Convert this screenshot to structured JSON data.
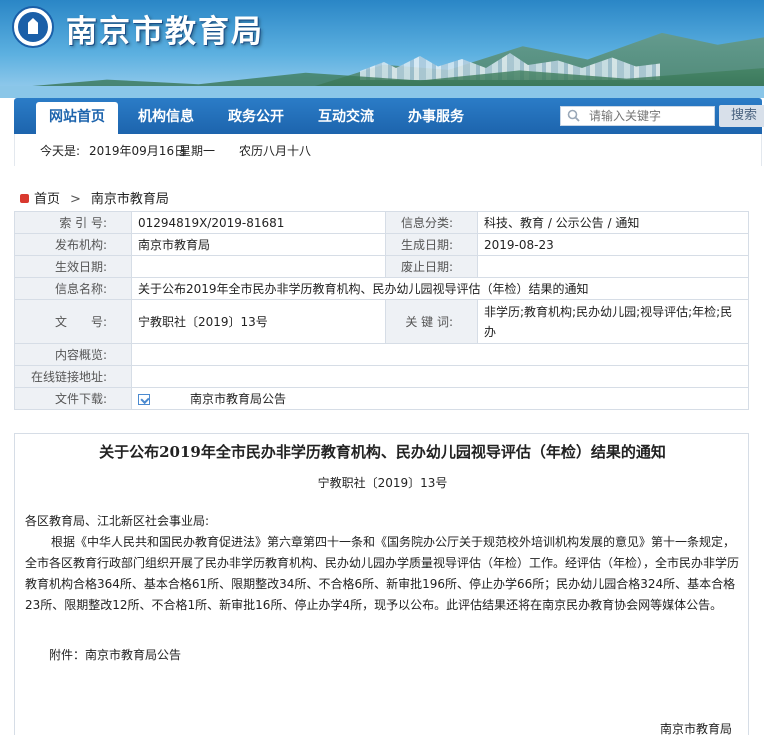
{
  "header": {
    "site_title": "南京市教育局"
  },
  "nav": {
    "items": [
      "网站首页",
      "机构信息",
      "政务公开",
      "互动交流",
      "办事服务"
    ],
    "search_placeholder": "请输入关键字",
    "search_button": "搜索"
  },
  "datebar": {
    "today_label": "今天是:",
    "date": "2019年09月16日",
    "weekday": "星期一",
    "lunar": "农历八月十八"
  },
  "breadcrumb": {
    "home": "首页",
    "current": "南京市教育局"
  },
  "meta": {
    "index_label": "索 引 号:",
    "index_value": "01294819X/2019-81681",
    "category_label": "信息分类:",
    "category_value": "科技、教育 / 公示公告 / 通知",
    "publisher_label": "发布机构:",
    "publisher_value": "南京市教育局",
    "created_label": "生成日期:",
    "created_value": "2019-08-23",
    "effective_label": "生效日期:",
    "effective_value": "",
    "repeal_label": "废止日期:",
    "repeal_value": "",
    "name_label": "信息名称:",
    "name_value": "关于公布2019年全市民办非学历教育机构、民办幼儿园视导评估（年检）结果的通知",
    "docno_label": "文　　号:",
    "docno_value": "宁教职社〔2019〕13号",
    "keywords_label": "关 键 词:",
    "keywords_value": "非学历;教育机构;民办幼儿园;视导评估;年检;民办",
    "summary_label": "内容概览:",
    "summary_value": "",
    "link_label": "在线链接地址:",
    "link_value": "",
    "download_label": "文件下载:",
    "download_value": "南京市教育局公告"
  },
  "article": {
    "title": "关于公布2019年全市民办非学历教育机构、民办幼儿园视导评估（年检）结果的通知",
    "docno": "宁教职社〔2019〕13号",
    "greeting": "各区教育局、江北新区社会事业局:",
    "body": "根据《中华人民共和国民办教育促进法》第六章第四十一条和《国务院办公厅关于规范校外培训机构发展的意见》第十一条规定，全市各区教育行政部门组织开展了民办非学历教育机构、民办幼儿园办学质量视导评估（年检）工作。经评估（年检），全市民办非学历教育机构合格364所、基本合格61所、限期整改34所、不合格6所、新审批196所、停止办学66所；民办幼儿园合格324所、基本合格23所、限期整改12所、不合格1所、新审批16所、停止办学4所，现予以公布。此评估结果还将在南京民办教育协会网等媒体公告。",
    "attachment": "附件：南京市教育局公告",
    "signature": "南京市教育局"
  }
}
